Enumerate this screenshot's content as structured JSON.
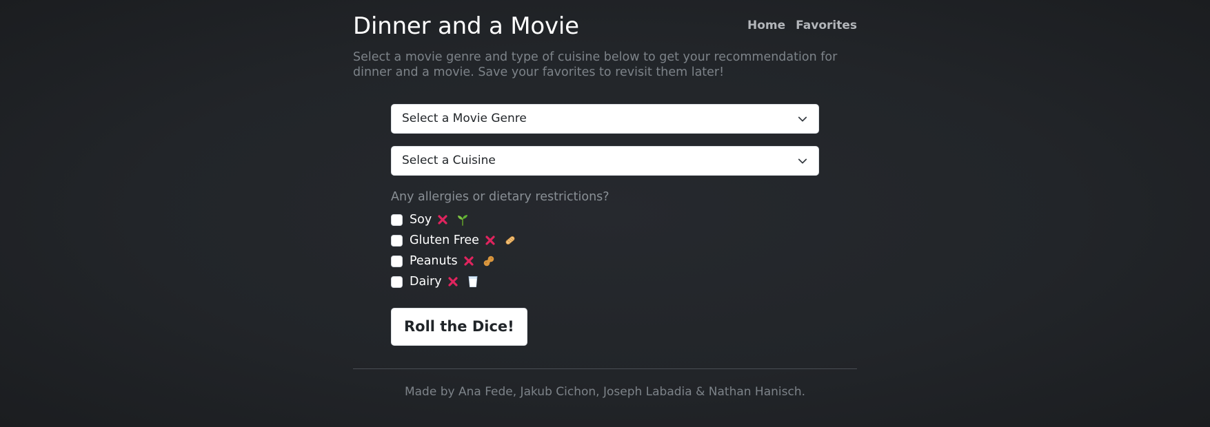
{
  "header": {
    "title": "Dinner and a Movie",
    "nav": [
      "Home",
      "Favorites"
    ]
  },
  "lead": "Select a movie genre and type of cuisine below to get your recommendation for dinner and a movie. Save your favorites to revisit them later!",
  "form": {
    "genre_select": "Select a Movie Genre",
    "cuisine_select": "Select a Cuisine",
    "allergy_question": "Any allergies or dietary restrictions?",
    "options": [
      {
        "label": "Soy",
        "icon": "seedling-icon"
      },
      {
        "label": "Gluten Free",
        "icon": "bread-icon"
      },
      {
        "label": "Peanuts",
        "icon": "peanut-icon"
      },
      {
        "label": "Dairy",
        "icon": "milk-glass-icon"
      }
    ],
    "submit_label": "Roll the Dice!"
  },
  "footer": {
    "credits": "Made by Ana Fede, Jakub Cichon, Joseph Labadia & Nathan Hanisch."
  },
  "colors": {
    "background": "#22252a",
    "muted_text": "#7d8389",
    "x_mark": "#e0245e"
  }
}
